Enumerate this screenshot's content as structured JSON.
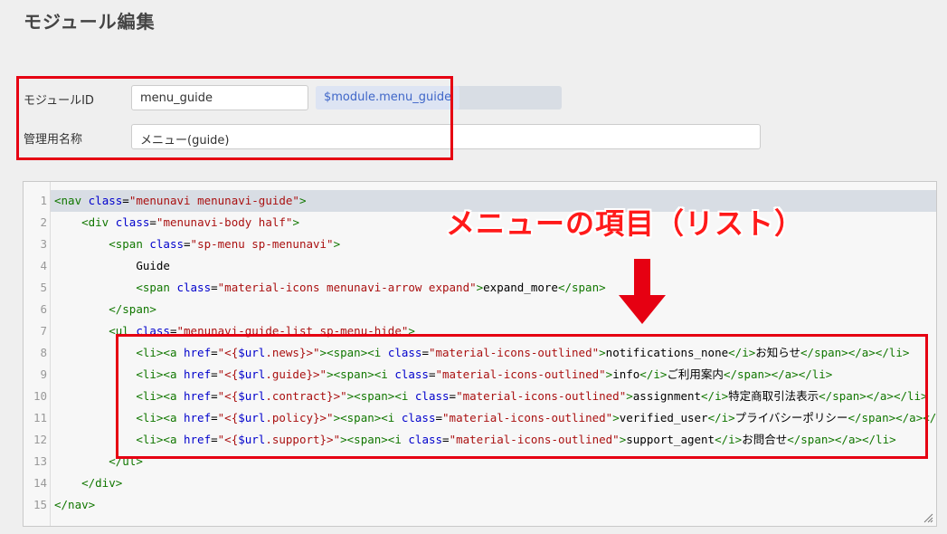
{
  "page": {
    "title": "モジュール編集"
  },
  "form": {
    "module_id": {
      "label": "モジュールID",
      "value": "menu_guide",
      "variable": "$module.menu_guide"
    },
    "admin_name": {
      "label": "管理用名称",
      "value": "メニュー(guide)"
    }
  },
  "editor": {
    "lines": [
      {
        "num": "1",
        "indent": "",
        "tokens": [
          {
            "t": "tag",
            "v": "<nav "
          },
          {
            "t": "attr",
            "v": "class"
          },
          {
            "t": "txt",
            "v": "="
          },
          {
            "t": "str",
            "v": "\"menunavi menunavi-guide\""
          },
          {
            "t": "tag",
            "v": ">"
          }
        ]
      },
      {
        "num": "2",
        "indent": "    ",
        "tokens": [
          {
            "t": "tag",
            "v": "<div "
          },
          {
            "t": "attr",
            "v": "class"
          },
          {
            "t": "txt",
            "v": "="
          },
          {
            "t": "str",
            "v": "\"menunavi-body half\""
          },
          {
            "t": "tag",
            "v": ">"
          }
        ]
      },
      {
        "num": "3",
        "indent": "        ",
        "tokens": [
          {
            "t": "tag",
            "v": "<span "
          },
          {
            "t": "attr",
            "v": "class"
          },
          {
            "t": "txt",
            "v": "="
          },
          {
            "t": "str",
            "v": "\"sp-menu sp-menunavi\""
          },
          {
            "t": "tag",
            "v": ">"
          }
        ]
      },
      {
        "num": "4",
        "indent": "            ",
        "tokens": [
          {
            "t": "txt",
            "v": "Guide"
          }
        ]
      },
      {
        "num": "5",
        "indent": "            ",
        "tokens": [
          {
            "t": "tag",
            "v": "<span "
          },
          {
            "t": "attr",
            "v": "class"
          },
          {
            "t": "txt",
            "v": "="
          },
          {
            "t": "str",
            "v": "\"material-icons menunavi-arrow expand\""
          },
          {
            "t": "tag",
            "v": ">"
          },
          {
            "t": "txt",
            "v": "expand_more"
          },
          {
            "t": "tag",
            "v": "</span>"
          }
        ]
      },
      {
        "num": "6",
        "indent": "        ",
        "tokens": [
          {
            "t": "tag",
            "v": "</span>"
          }
        ]
      },
      {
        "num": "7",
        "indent": "        ",
        "tokens": [
          {
            "t": "tag",
            "v": "<ul "
          },
          {
            "t": "attr",
            "v": "class"
          },
          {
            "t": "txt",
            "v": "="
          },
          {
            "t": "str",
            "v": "\"menunavi-guide-list sp-menu-hide\""
          },
          {
            "t": "tag",
            "v": ">"
          }
        ]
      },
      {
        "num": "8",
        "indent": "            ",
        "tokens": [
          {
            "t": "tag",
            "v": "<li><a "
          },
          {
            "t": "attr",
            "v": "href"
          },
          {
            "t": "txt",
            "v": "="
          },
          {
            "t": "str",
            "v": "\"<{"
          },
          {
            "t": "attr",
            "v": "$url"
          },
          {
            "t": "str",
            "v": ".news}>\""
          },
          {
            "t": "tag",
            "v": "><span><i "
          },
          {
            "t": "attr",
            "v": "class"
          },
          {
            "t": "txt",
            "v": "="
          },
          {
            "t": "str",
            "v": "\"material-icons-outlined\""
          },
          {
            "t": "tag",
            "v": ">"
          },
          {
            "t": "txt",
            "v": "notifications_none"
          },
          {
            "t": "tag",
            "v": "</i>"
          },
          {
            "t": "txt",
            "v": "お知らせ"
          },
          {
            "t": "tag",
            "v": "</span></a></li>"
          }
        ]
      },
      {
        "num": "9",
        "indent": "            ",
        "tokens": [
          {
            "t": "tag",
            "v": "<li><a "
          },
          {
            "t": "attr",
            "v": "href"
          },
          {
            "t": "txt",
            "v": "="
          },
          {
            "t": "str",
            "v": "\"<{"
          },
          {
            "t": "attr",
            "v": "$url"
          },
          {
            "t": "str",
            "v": ".guide}>\""
          },
          {
            "t": "tag",
            "v": "><span><i "
          },
          {
            "t": "attr",
            "v": "class"
          },
          {
            "t": "txt",
            "v": "="
          },
          {
            "t": "str",
            "v": "\"material-icons-outlined\""
          },
          {
            "t": "tag",
            "v": ">"
          },
          {
            "t": "txt",
            "v": "info"
          },
          {
            "t": "tag",
            "v": "</i>"
          },
          {
            "t": "txt",
            "v": "ご利用案内"
          },
          {
            "t": "tag",
            "v": "</span></a></li>"
          }
        ]
      },
      {
        "num": "10",
        "indent": "            ",
        "tokens": [
          {
            "t": "tag",
            "v": "<li><a "
          },
          {
            "t": "attr",
            "v": "href"
          },
          {
            "t": "txt",
            "v": "="
          },
          {
            "t": "str",
            "v": "\"<{"
          },
          {
            "t": "attr",
            "v": "$url"
          },
          {
            "t": "str",
            "v": ".contract}>\""
          },
          {
            "t": "tag",
            "v": "><span><i "
          },
          {
            "t": "attr",
            "v": "class"
          },
          {
            "t": "txt",
            "v": "="
          },
          {
            "t": "str",
            "v": "\"material-icons-outlined\""
          },
          {
            "t": "tag",
            "v": ">"
          },
          {
            "t": "txt",
            "v": "assignment"
          },
          {
            "t": "tag",
            "v": "</i>"
          },
          {
            "t": "txt",
            "v": "特定商取引法表示"
          },
          {
            "t": "tag",
            "v": "</span></a></li>"
          }
        ]
      },
      {
        "num": "11",
        "indent": "            ",
        "tokens": [
          {
            "t": "tag",
            "v": "<li><a "
          },
          {
            "t": "attr",
            "v": "href"
          },
          {
            "t": "txt",
            "v": "="
          },
          {
            "t": "str",
            "v": "\"<{"
          },
          {
            "t": "attr",
            "v": "$url"
          },
          {
            "t": "str",
            "v": ".policy}>\""
          },
          {
            "t": "tag",
            "v": "><span><i "
          },
          {
            "t": "attr",
            "v": "class"
          },
          {
            "t": "txt",
            "v": "="
          },
          {
            "t": "str",
            "v": "\"material-icons-outlined\""
          },
          {
            "t": "tag",
            "v": ">"
          },
          {
            "t": "txt",
            "v": "verified_user"
          },
          {
            "t": "tag",
            "v": "</i>"
          },
          {
            "t": "txt",
            "v": "プライバシーポリシー"
          },
          {
            "t": "tag",
            "v": "</span></a></li>"
          }
        ]
      },
      {
        "num": "12",
        "indent": "            ",
        "tokens": [
          {
            "t": "tag",
            "v": "<li><a "
          },
          {
            "t": "attr",
            "v": "href"
          },
          {
            "t": "txt",
            "v": "="
          },
          {
            "t": "str",
            "v": "\"<{"
          },
          {
            "t": "attr",
            "v": "$url"
          },
          {
            "t": "str",
            "v": ".support}>\""
          },
          {
            "t": "tag",
            "v": "><span><i "
          },
          {
            "t": "attr",
            "v": "class"
          },
          {
            "t": "txt",
            "v": "="
          },
          {
            "t": "str",
            "v": "\"material-icons-outlined\""
          },
          {
            "t": "tag",
            "v": ">"
          },
          {
            "t": "txt",
            "v": "support_agent"
          },
          {
            "t": "tag",
            "v": "</i>"
          },
          {
            "t": "txt",
            "v": "お問合せ"
          },
          {
            "t": "tag",
            "v": "</span></a></li>"
          }
        ]
      },
      {
        "num": "13",
        "indent": "        ",
        "tokens": [
          {
            "t": "tag",
            "v": "</ul>"
          }
        ]
      },
      {
        "num": "14",
        "indent": "    ",
        "tokens": [
          {
            "t": "tag",
            "v": "</div>"
          }
        ]
      },
      {
        "num": "15",
        "indent": "",
        "tokens": [
          {
            "t": "tag",
            "v": "</nav>"
          }
        ]
      }
    ]
  },
  "annotation": {
    "text": "メニューの項目（リスト）"
  },
  "colors": {
    "highlight": "#e60012",
    "annotation": "#ff1a1a",
    "variable": "#3f66c8"
  }
}
